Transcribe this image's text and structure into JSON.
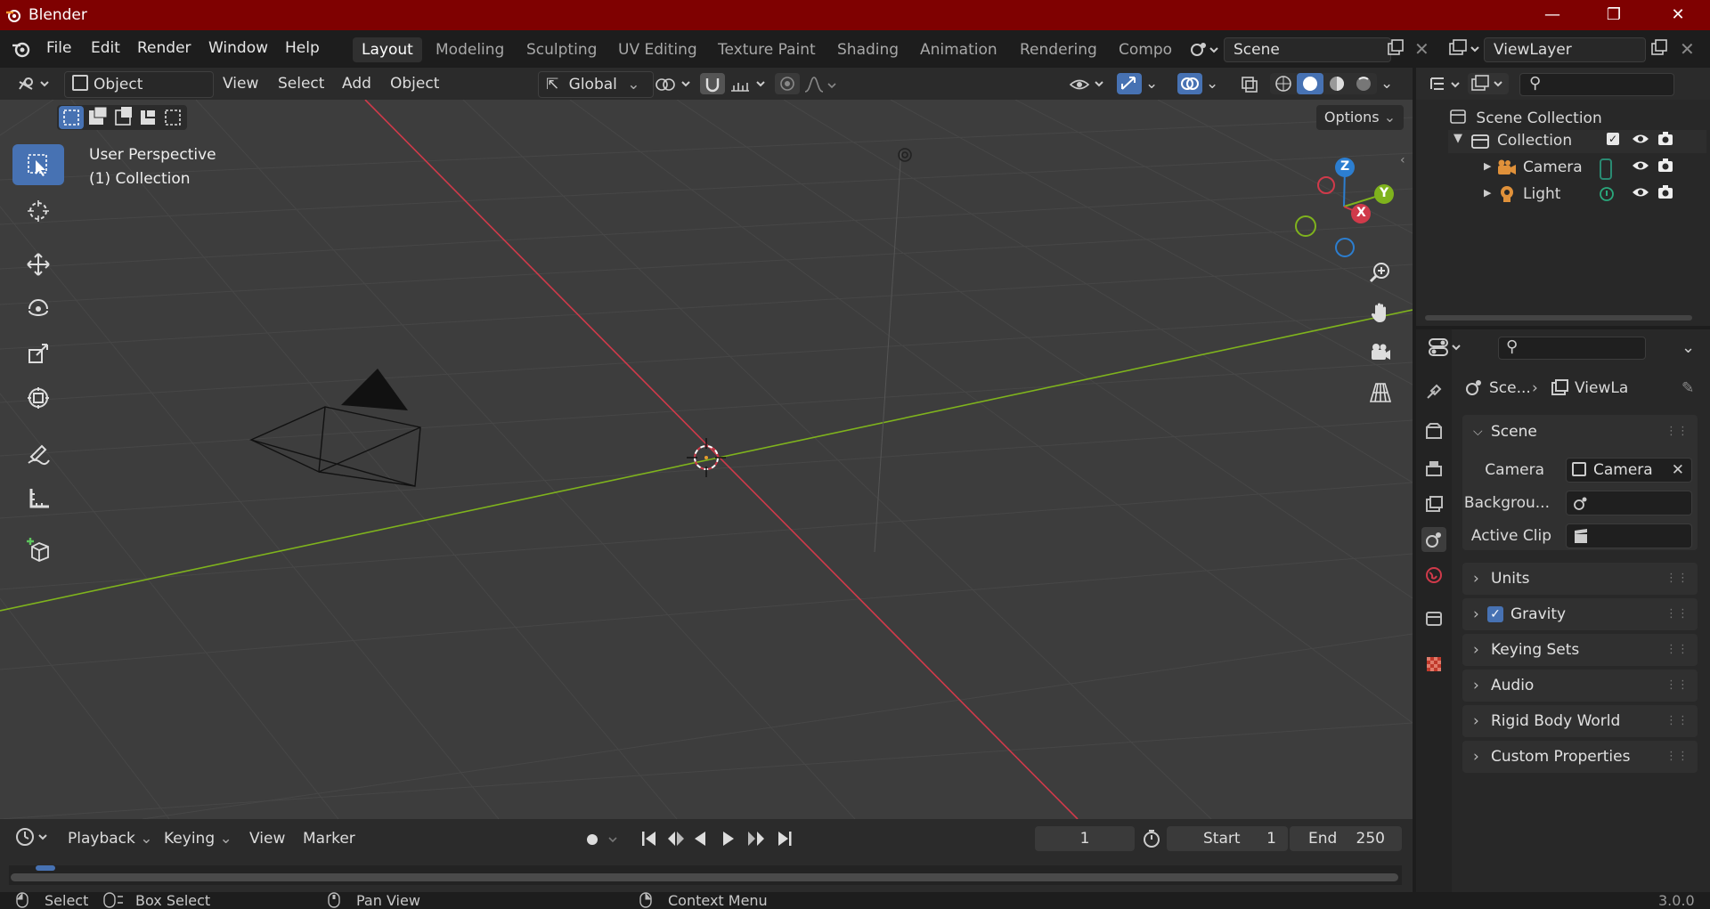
{
  "app": {
    "title": "Blender",
    "version": "3.0.0"
  },
  "menu": [
    "File",
    "Edit",
    "Render",
    "Window",
    "Help"
  ],
  "workspaces": [
    "Layout",
    "Modeling",
    "Sculpting",
    "UV Editing",
    "Texture Paint",
    "Shading",
    "Animation",
    "Rendering",
    "Compo"
  ],
  "scene_selector": {
    "value": "Scene"
  },
  "viewlayer_selector": {
    "value": "ViewLayer"
  },
  "viewport_header": {
    "mode": "Object Mode",
    "menus": [
      "View",
      "Select",
      "Add",
      "Object"
    ],
    "transform_orientation": "Global",
    "options_label": "Options"
  },
  "viewport": {
    "perspective_label": "User Perspective",
    "collection_label": "(1) Collection",
    "gizmo_axes": {
      "x": "X",
      "y": "Y",
      "z": "Z"
    }
  },
  "outliner": {
    "root": "Scene Collection",
    "collection": "Collection",
    "objects": [
      "Camera",
      "Light"
    ]
  },
  "properties": {
    "breadcrumb_scene": "Sce...",
    "breadcrumb_viewlayer": "ViewLa",
    "scene_panel": {
      "title": "Scene",
      "camera_label": "Camera",
      "camera_value": "Camera",
      "background_label": "Backgrou...",
      "active_clip_label": "Active Clip"
    },
    "collapsed_panels": [
      "Units",
      "Gravity",
      "Keying Sets",
      "Audio",
      "Rigid Body World",
      "Custom Properties"
    ]
  },
  "timeline": {
    "menus": [
      "Playback",
      "Keying",
      "View",
      "Marker"
    ],
    "current_frame": "1",
    "start_label": "Start",
    "start_value": "1",
    "end_label": "End",
    "end_value": "250"
  },
  "statusbar": {
    "select": "Select",
    "box_select": "Box Select",
    "pan_view": "Pan View",
    "context_menu": "Context Menu"
  },
  "colors": {
    "accent": "#4772b3",
    "titlebar": "#7f0101",
    "x_axis": "#d03a4a",
    "y_axis": "#7fb31d",
    "z_axis": "#2c7ed0"
  }
}
